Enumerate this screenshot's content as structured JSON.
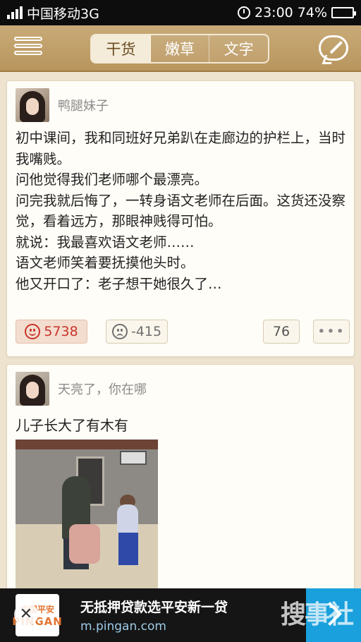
{
  "status_bar": {
    "carrier": "中国移动3G",
    "time": "23:00",
    "battery": "74%",
    "battery_level": 0.74
  },
  "nav": {
    "tabs": [
      {
        "label": "干货",
        "active": true
      },
      {
        "label": "嫩草",
        "active": false
      },
      {
        "label": "文字",
        "active": false
      }
    ]
  },
  "posts": [
    {
      "author": "鸭腿妹子",
      "text": "初中课间，我和同班好兄弟趴在走廊边的护栏上，当时我嘴贱。\n问他觉得我们老师哪个最漂亮。\n问完我就后悔了，一转身语文老师在后面。这货还没察觉，看着远方，那眼神贱得可怕。\n就说：我最喜欢语文老师……\n语文老师笑着要抚摸他头时。\n他又开口了：老子想干她很久了…",
      "likes": "5738",
      "dislikes": "-415",
      "comments": "76",
      "more": "•••"
    },
    {
      "author": "天亮了，你在哪",
      "text": "儿子长大了有木有"
    }
  ],
  "ad": {
    "logo_top": "中国平安",
    "logo_bottom": "PINGAN",
    "close": "✕",
    "title": "无抵押贷款选平安新一贷",
    "url": "m.pingan.com"
  },
  "watermark": "搜事社",
  "colors": {
    "nav_bg": "#c4a26f",
    "like_red": "#c8342a",
    "ad_blue": "#1aa0dc"
  }
}
